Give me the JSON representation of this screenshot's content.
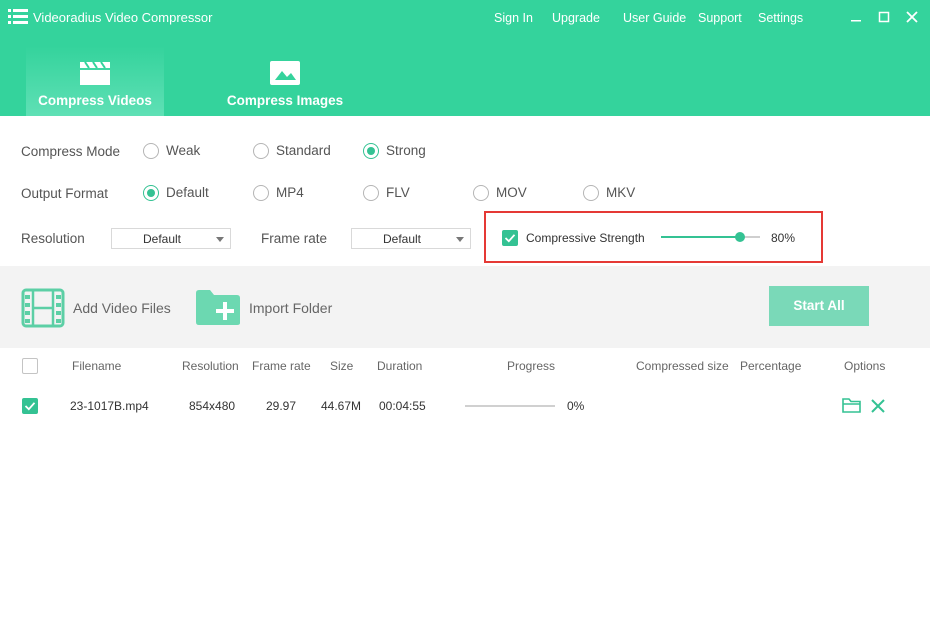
{
  "app": {
    "title": "Videoradius Video Compressor"
  },
  "nav": {
    "sign_in": "Sign In",
    "upgrade": "Upgrade",
    "user_guide": "User Guide",
    "support": "Support",
    "settings": "Settings"
  },
  "tabs": [
    {
      "label": "Compress Videos",
      "active": true,
      "icon": "clapperboard-icon"
    },
    {
      "label": "Compress Images",
      "active": false,
      "icon": "image-icon"
    }
  ],
  "compress_mode": {
    "label": "Compress Mode",
    "options": [
      "Weak",
      "Standard",
      "Strong"
    ],
    "selected": "Strong"
  },
  "output_format": {
    "label": "Output Format",
    "options": [
      "Default",
      "MP4",
      "FLV",
      "MOV",
      "MKV"
    ],
    "selected": "Default"
  },
  "resolution": {
    "label": "Resolution",
    "value": "Default"
  },
  "frame_rate": {
    "label": "Frame rate",
    "value": "Default"
  },
  "strength": {
    "label": "Compressive Strength",
    "enabled": true,
    "value_text": "80%",
    "value": 0.8
  },
  "toolbar": {
    "add_video_files": "Add Video Files",
    "import_folder": "Import Folder",
    "start_all": "Start All"
  },
  "table": {
    "columns": [
      "Filename",
      "Resolution",
      "Frame rate",
      "Size",
      "Duration",
      "Progress",
      "Compressed size",
      "Percentage",
      "Options"
    ],
    "rows": [
      {
        "checked": true,
        "filename": "23-1017B.mp4",
        "resolution": "854x480",
        "frame_rate": "29.97",
        "size": "44.67M",
        "duration": "00:04:55",
        "progress": 0,
        "progress_text": "0%",
        "compressed_size": "",
        "percentage": ""
      }
    ]
  },
  "colors": {
    "brand": "#34d39c",
    "accent": "#34c293",
    "start_button": "#7ad9b8",
    "highlight": "#e53935"
  }
}
